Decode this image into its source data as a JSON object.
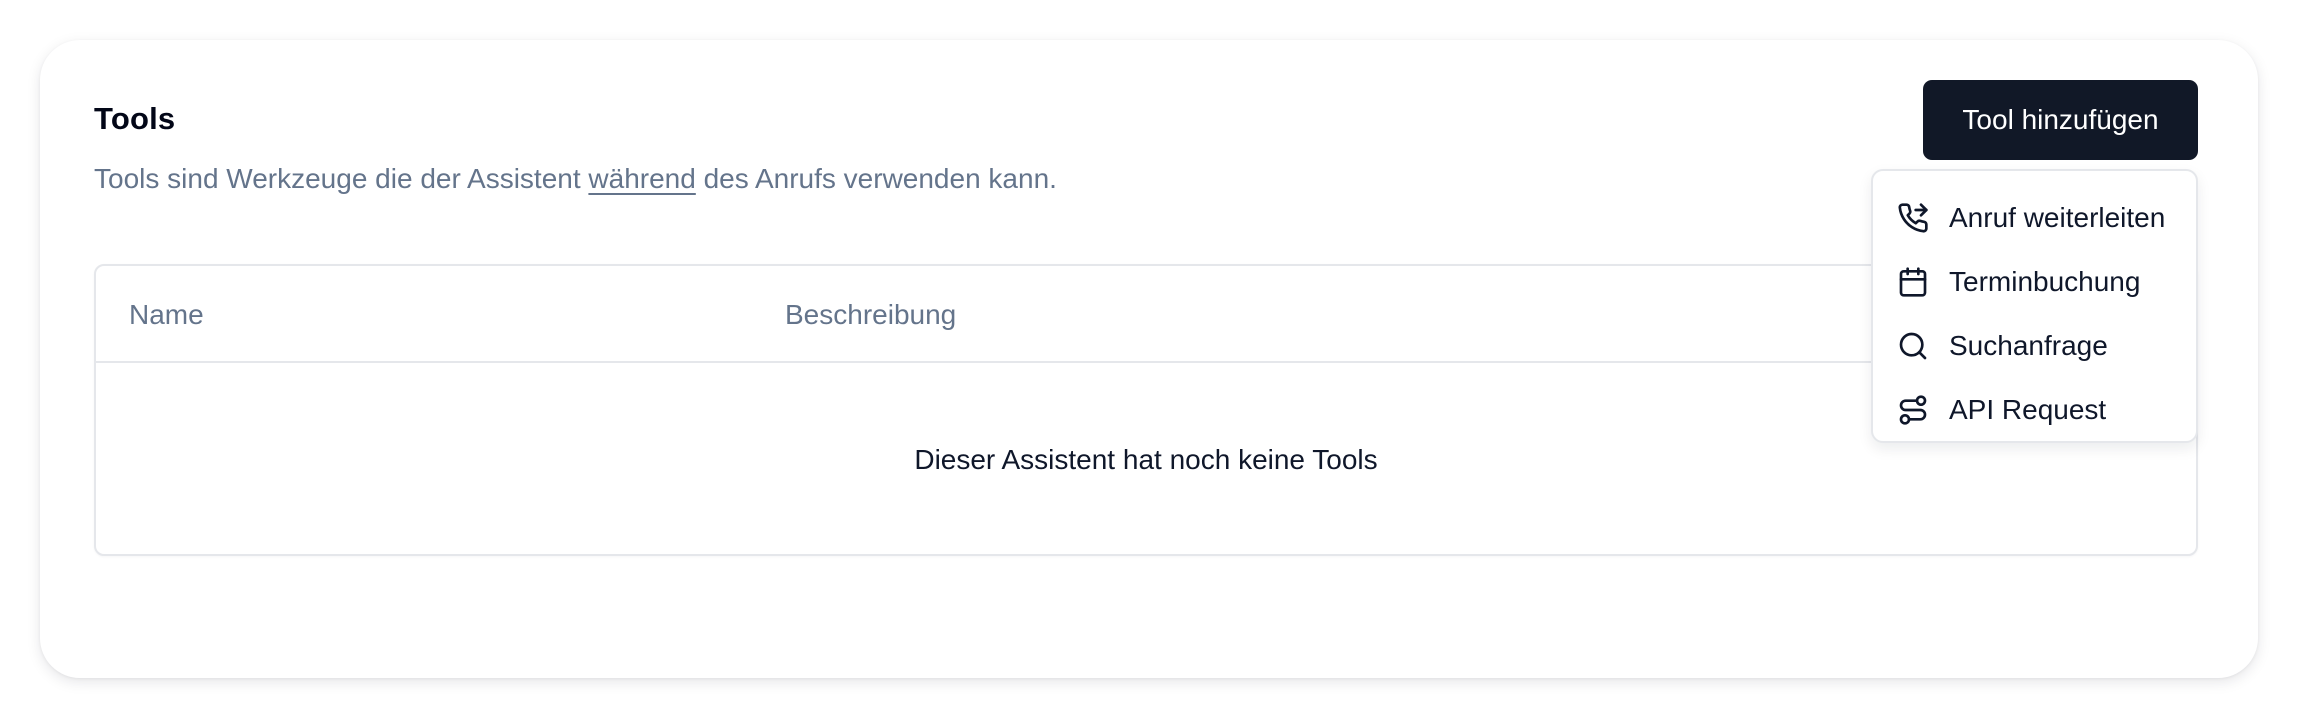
{
  "section": {
    "title": "Tools",
    "subtitle_before": "Tools sind Werkzeuge die der Assistent ",
    "subtitle_underlined": "während",
    "subtitle_after": " des Anrufs verwenden kann."
  },
  "add_button": {
    "label": "Tool hinzufügen"
  },
  "table": {
    "columns": [
      "Name",
      "Beschreibung"
    ],
    "empty_message": "Dieser Assistent hat noch keine Tools"
  },
  "menu": {
    "items": [
      {
        "label": "Anruf weiterleiten",
        "icon": "phone-forward-icon"
      },
      {
        "label": "Terminbuchung",
        "icon": "calendar-icon"
      },
      {
        "label": "Suchanfrage",
        "icon": "search-icon"
      },
      {
        "label": "API Request",
        "icon": "route-icon"
      }
    ]
  },
  "colors": {
    "button_bg": "#111827",
    "muted_text": "#64748b",
    "border": "#e5e7eb"
  }
}
